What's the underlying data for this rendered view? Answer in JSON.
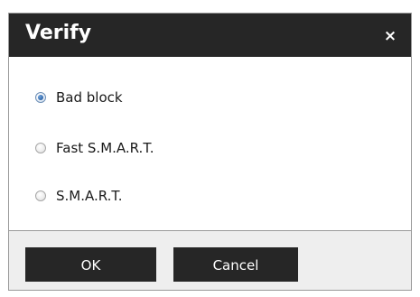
{
  "dialog": {
    "title": "Verify",
    "close_glyph": "×"
  },
  "options": [
    {
      "label": "Bad block",
      "checked": true
    },
    {
      "label": "Fast S.M.A.R.T.",
      "checked": false
    },
    {
      "label": "S.M.A.R.T.",
      "checked": false
    }
  ],
  "buttons": {
    "ok_label": "OK",
    "cancel_label": "Cancel"
  },
  "colors": {
    "titlebar": "#262626",
    "button": "#262626",
    "footer": "#eeeeee",
    "radio_selected": "#2f67a9"
  }
}
